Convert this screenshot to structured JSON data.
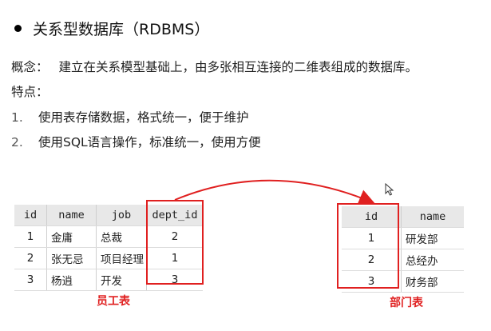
{
  "heading": "关系型数据库（RDBMS）",
  "concept_label": "概念：",
  "concept_text": "建立在关系模型基础上，由多张相互连接的二维表组成的数据库。",
  "features_label": "特点：",
  "features": [
    {
      "num": "1.",
      "text": "使用表存储数据，格式统一，便于维护"
    },
    {
      "num": "2.",
      "text": "使用SQL语言操作，标准统一，使用方便"
    }
  ],
  "emp_table": {
    "columns": [
      "id",
      "name",
      "job",
      "dept_id"
    ],
    "rows": [
      [
        "1",
        "金庸",
        "总裁",
        "2"
      ],
      [
        "2",
        "张无忌",
        "项目经理",
        "1"
      ],
      [
        "3",
        "杨逍",
        "开发",
        "3"
      ]
    ],
    "caption": "员工表"
  },
  "dept_table": {
    "columns": [
      "id",
      "name"
    ],
    "rows": [
      [
        "1",
        "研发部"
      ],
      [
        "2",
        "总经办"
      ],
      [
        "3",
        "财务部"
      ]
    ],
    "caption": "部门表"
  },
  "colors": {
    "highlight": "#e02020",
    "header_bg": "#e8e8e8"
  }
}
